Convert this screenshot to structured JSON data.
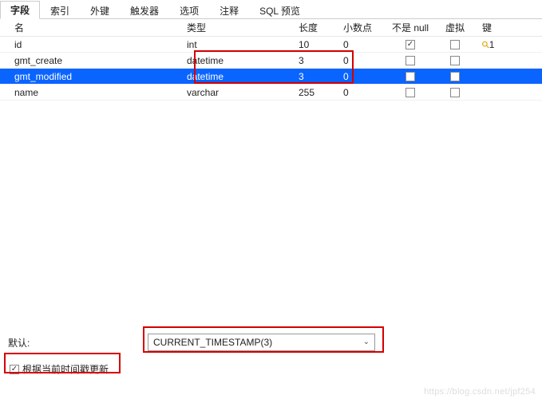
{
  "tabs": {
    "items": [
      {
        "label": "字段",
        "active": true
      },
      {
        "label": "索引"
      },
      {
        "label": "外键"
      },
      {
        "label": "触发器"
      },
      {
        "label": "选项"
      },
      {
        "label": "注释"
      },
      {
        "label": "SQL 预览"
      }
    ]
  },
  "columns": {
    "name": "名",
    "type": "类型",
    "length": "长度",
    "decimal": "小数点",
    "notnull": "不是 null",
    "virtual": "虚拟",
    "key": "键"
  },
  "rows": [
    {
      "name": "id",
      "type": "int",
      "length": "10",
      "decimal": "0",
      "notnull": true,
      "virtual": false,
      "key": "1",
      "selected": false
    },
    {
      "name": "gmt_create",
      "type": "datetime",
      "length": "3",
      "decimal": "0",
      "notnull": false,
      "virtual": false,
      "key": "",
      "selected": false
    },
    {
      "name": "gmt_modified",
      "type": "datetime",
      "length": "3",
      "decimal": "0",
      "notnull": false,
      "virtual": false,
      "key": "",
      "selected": true
    },
    {
      "name": "name",
      "type": "varchar",
      "length": "255",
      "decimal": "0",
      "notnull": false,
      "virtual": false,
      "key": "",
      "selected": false
    }
  ],
  "default": {
    "label": "默认:",
    "value": "CURRENT_TIMESTAMP(3)"
  },
  "updateOnTimestamp": {
    "label": "根据当前时间戳更新",
    "checked": true
  },
  "watermark": "https://blog.csdn.net/jpf254"
}
